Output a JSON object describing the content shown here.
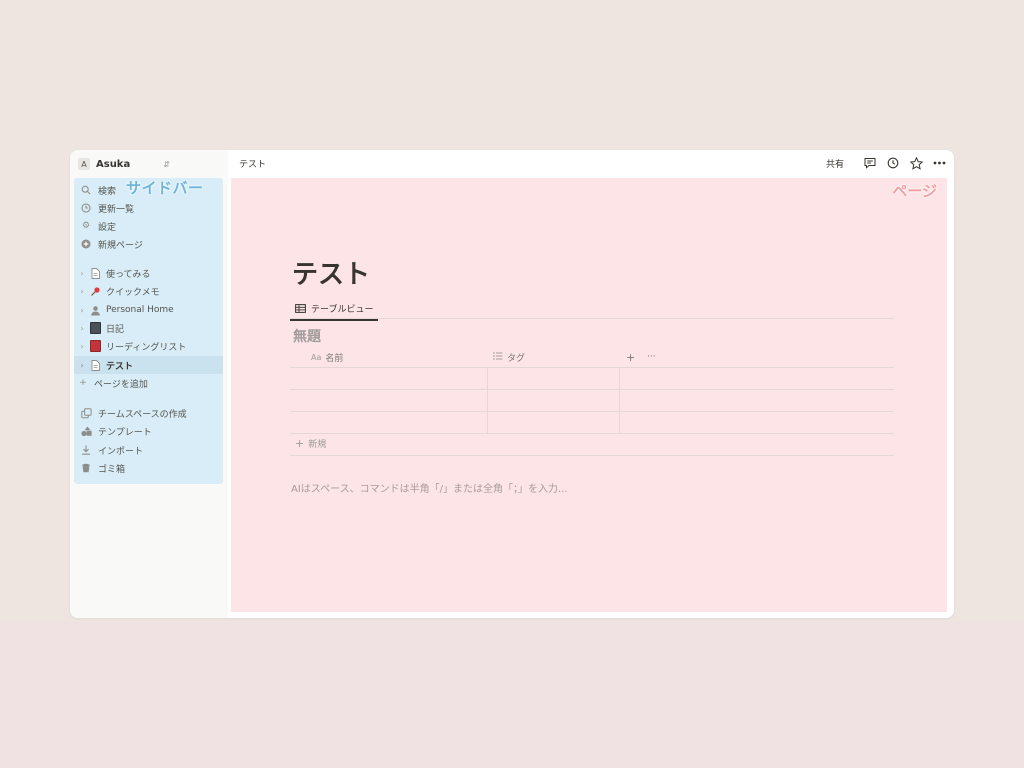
{
  "workspace": {
    "name": "Asuka",
    "avatar": "A"
  },
  "annotations": {
    "sidebar": "サイドバー",
    "page": "ページ"
  },
  "sidebar": {
    "top_items": [
      {
        "label": "検索",
        "icon": "search-icon"
      },
      {
        "label": "更新一覧",
        "icon": "clock-icon"
      },
      {
        "label": "設定",
        "icon": "gear-icon"
      },
      {
        "label": "新規ページ",
        "icon": "plus-circle-icon"
      }
    ],
    "pages": [
      {
        "label": "使ってみる",
        "icon": "page-icon"
      },
      {
        "label": "クイックメモ",
        "icon": "pin-icon"
      },
      {
        "label": "Personal Home",
        "icon": "person-icon"
      },
      {
        "label": "日記",
        "icon": "notebook-icon"
      },
      {
        "label": "リーディングリスト",
        "icon": "book-icon"
      },
      {
        "label": "テスト",
        "icon": "page-icon",
        "active": true
      }
    ],
    "add_page": "ページを追加",
    "bottom_items": [
      {
        "label": "チームスペースの作成",
        "icon": "teamspace-icon"
      },
      {
        "label": "テンプレート",
        "icon": "template-icon"
      },
      {
        "label": "インポート",
        "icon": "import-icon"
      },
      {
        "label": "ゴミ箱",
        "icon": "trash-icon"
      }
    ]
  },
  "topbar": {
    "breadcrumb": "テスト",
    "share_label": "共有",
    "icons": [
      "comment-icon",
      "history-icon",
      "star-icon",
      "more-icon"
    ]
  },
  "page": {
    "title": "テスト",
    "view_tab": "テーブルビュー",
    "database_title": "無題",
    "columns": [
      {
        "label": "名前",
        "icon_text": "Aa"
      },
      {
        "label": "タグ",
        "icon": "list-icon"
      }
    ],
    "add_column": "+",
    "column_more": "···",
    "row_count": 3,
    "new_row_label": "新規",
    "ai_hint": "AIはスペース、コマンドは半角「/」または全角「；」を入力..."
  },
  "colors": {
    "background": "#efe5e0",
    "sidebar_highlight": "#d8edf7",
    "sidebar_label": "#6fb4da",
    "page_highlight": "#fde4e6",
    "page_label": "#f29d9f"
  }
}
